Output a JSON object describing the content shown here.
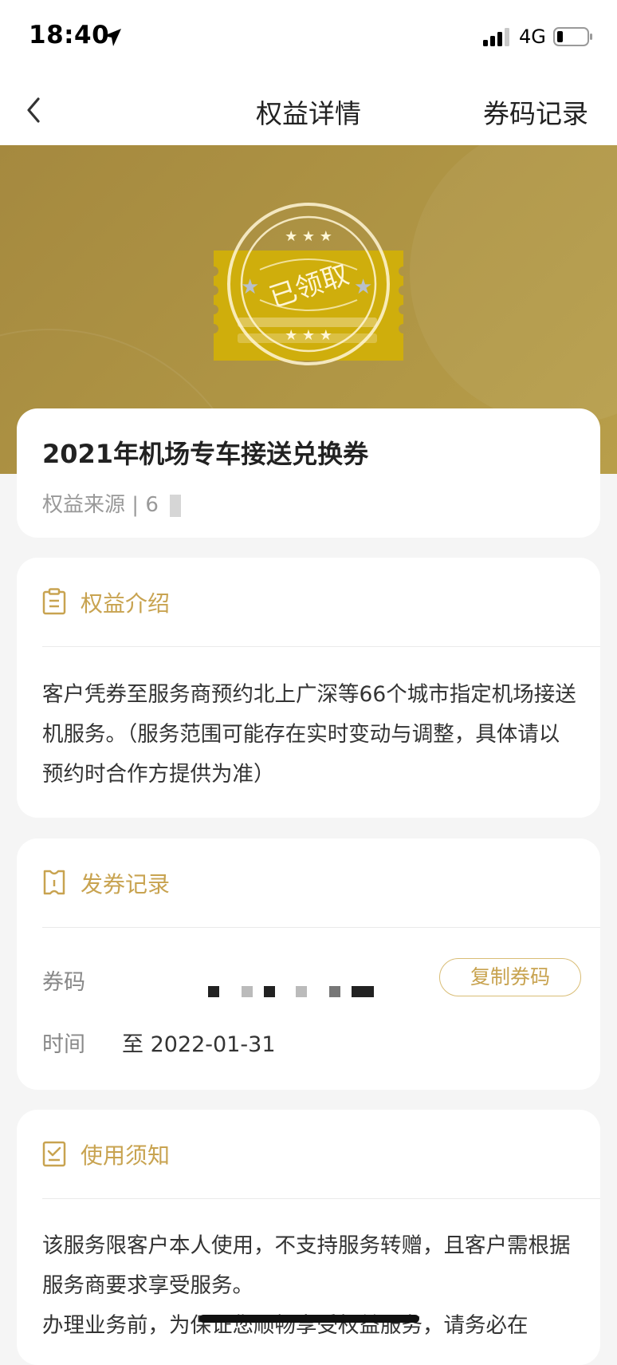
{
  "status_bar": {
    "time": "18:40",
    "network": "4G"
  },
  "nav": {
    "title": "权益详情",
    "right_link": "券码记录"
  },
  "banner": {
    "stamp_text": "已领取"
  },
  "summary": {
    "title": "2021年机场专车接送兑换券",
    "source_label": "权益来源",
    "separator": "|",
    "source_value": "6"
  },
  "intro": {
    "heading": "权益介绍",
    "text": "客户凭券至服务商预约北上广深等66个城市指定机场接送机服务。（服务范围可能存在实时变动与调整，具体请以预约时合作方提供为准）"
  },
  "issue_record": {
    "heading": "发券记录",
    "code_label": "券码",
    "copy_button": "复制券码",
    "time_label": "时间",
    "time_value": "至 2022-01-31"
  },
  "usage": {
    "heading": "使用须知",
    "line1": "该服务限客户本人使用，不支持服务转赠，且客户需根据服务商要求享受服务。",
    "line2": "办理业务前，为保证您顺畅享受权益服务，请务必在"
  },
  "colors": {
    "accent": "#c8a350",
    "banner": "#b09645"
  }
}
